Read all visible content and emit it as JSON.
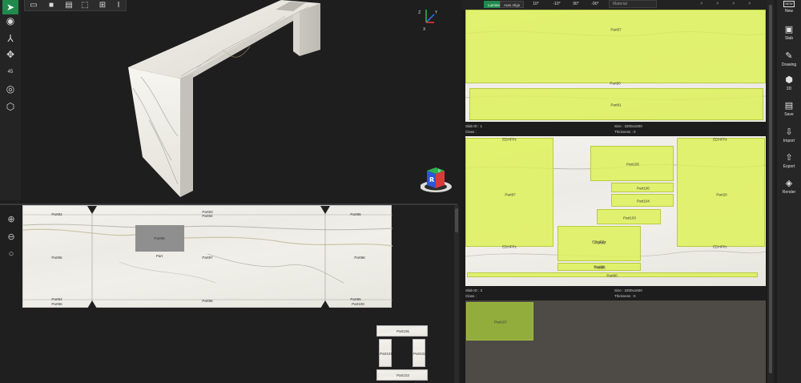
{
  "app": {
    "accent": "#1f8a4c",
    "part_color": "#ddf254"
  },
  "left_toolbar": {
    "items": [
      {
        "icon": "cursor-icon",
        "active": true
      },
      {
        "icon": "camera-orbit-icon"
      },
      {
        "icon": "axis-icon"
      },
      {
        "icon": "move-icon"
      },
      {
        "icon": "angle-45-icon",
        "label": "45"
      },
      {
        "icon": "eye-icon"
      },
      {
        "icon": "cube-icon"
      }
    ]
  },
  "top_toolbar": {
    "items": [
      "view-split-icon",
      "view-single-icon",
      "page-icon",
      "box-outline-icon",
      "grid-icon",
      "text-cursor-icon"
    ]
  },
  "viewport3d": {
    "axis_gizmo": {
      "x": "X",
      "y": "Y",
      "z": "Z"
    },
    "view_cube": {
      "face": "R",
      "side": "B"
    }
  },
  "viewport2d": {
    "zoom": [
      "zoom-in-icon",
      "zoom-out-icon",
      "zoom-fit-icon"
    ],
    "labels": {
      "p_tl": "Part92",
      "p_top1": "Part93",
      "p_top2": "Part94",
      "p_tr": "Part95",
      "p_left": "Part95",
      "p_center": "Part97",
      "p_right": "Part98",
      "p_sink": "Part99",
      "p_sink_sub": "Part",
      "p_bot_l": "Part96",
      "p_bot_c": "Part95",
      "p_bot_r": "Part100",
      "p_bot_tl": "Part94",
      "p_bot_tr": "Part96"
    },
    "thumbnail": {
      "top": "Part106",
      "left": "Part101",
      "right": "Part102",
      "bottom": "Part103"
    }
  },
  "right_panel": {
    "toolbar": {
      "buttons": [
        "Lumina",
        "Auto Align"
      ],
      "rotations": [
        "10°",
        "-10°",
        "90°",
        "-90°"
      ],
      "search_value": "Material"
    },
    "slab1": {
      "parts": {
        "a": "Part57",
        "b": "Part90",
        "c": "Part91"
      },
      "info": {
        "slab_id": "Slab ID : 1",
        "size": "Size : 3200x1600",
        "class": "Class :",
        "thickness": "Thickness : 0"
      }
    },
    "slab2": {
      "parts": {
        "a": "Part97",
        "b": "Part105",
        "c": "Part100",
        "d": "Part104",
        "e": "Part103",
        "f": "Part20",
        "g": "Part99",
        "h": "Part96",
        "i": "Part98",
        "j": "Part80"
      },
      "edge_labels": {
        "tl": "EDHFPz",
        "bl": "EDHFPz",
        "tr": "EDHFPz",
        "mid": "EDHFPz",
        "br": "EDHFPz"
      },
      "info": {
        "slab_id": "Slab ID : 3",
        "size": "Size : 3200x1600",
        "class": "Class :",
        "thickness": "Thickness : 0"
      }
    },
    "slab3": {
      "parts": {
        "a": "Part107"
      }
    }
  },
  "sidebar": {
    "items": [
      {
        "icon": "new-icon",
        "label": "New",
        "badge": "NEW"
      },
      {
        "icon": "slab-icon",
        "label": "Slab"
      },
      {
        "icon": "drawing-icon",
        "label": "Drawing"
      },
      {
        "icon": "3d-icon",
        "label": "3D"
      },
      {
        "icon": "save-icon",
        "label": "Save"
      },
      {
        "icon": "import-icon",
        "label": "Import"
      },
      {
        "icon": "export-icon",
        "label": "Export"
      },
      {
        "icon": "render-icon",
        "label": "Render"
      }
    ]
  }
}
